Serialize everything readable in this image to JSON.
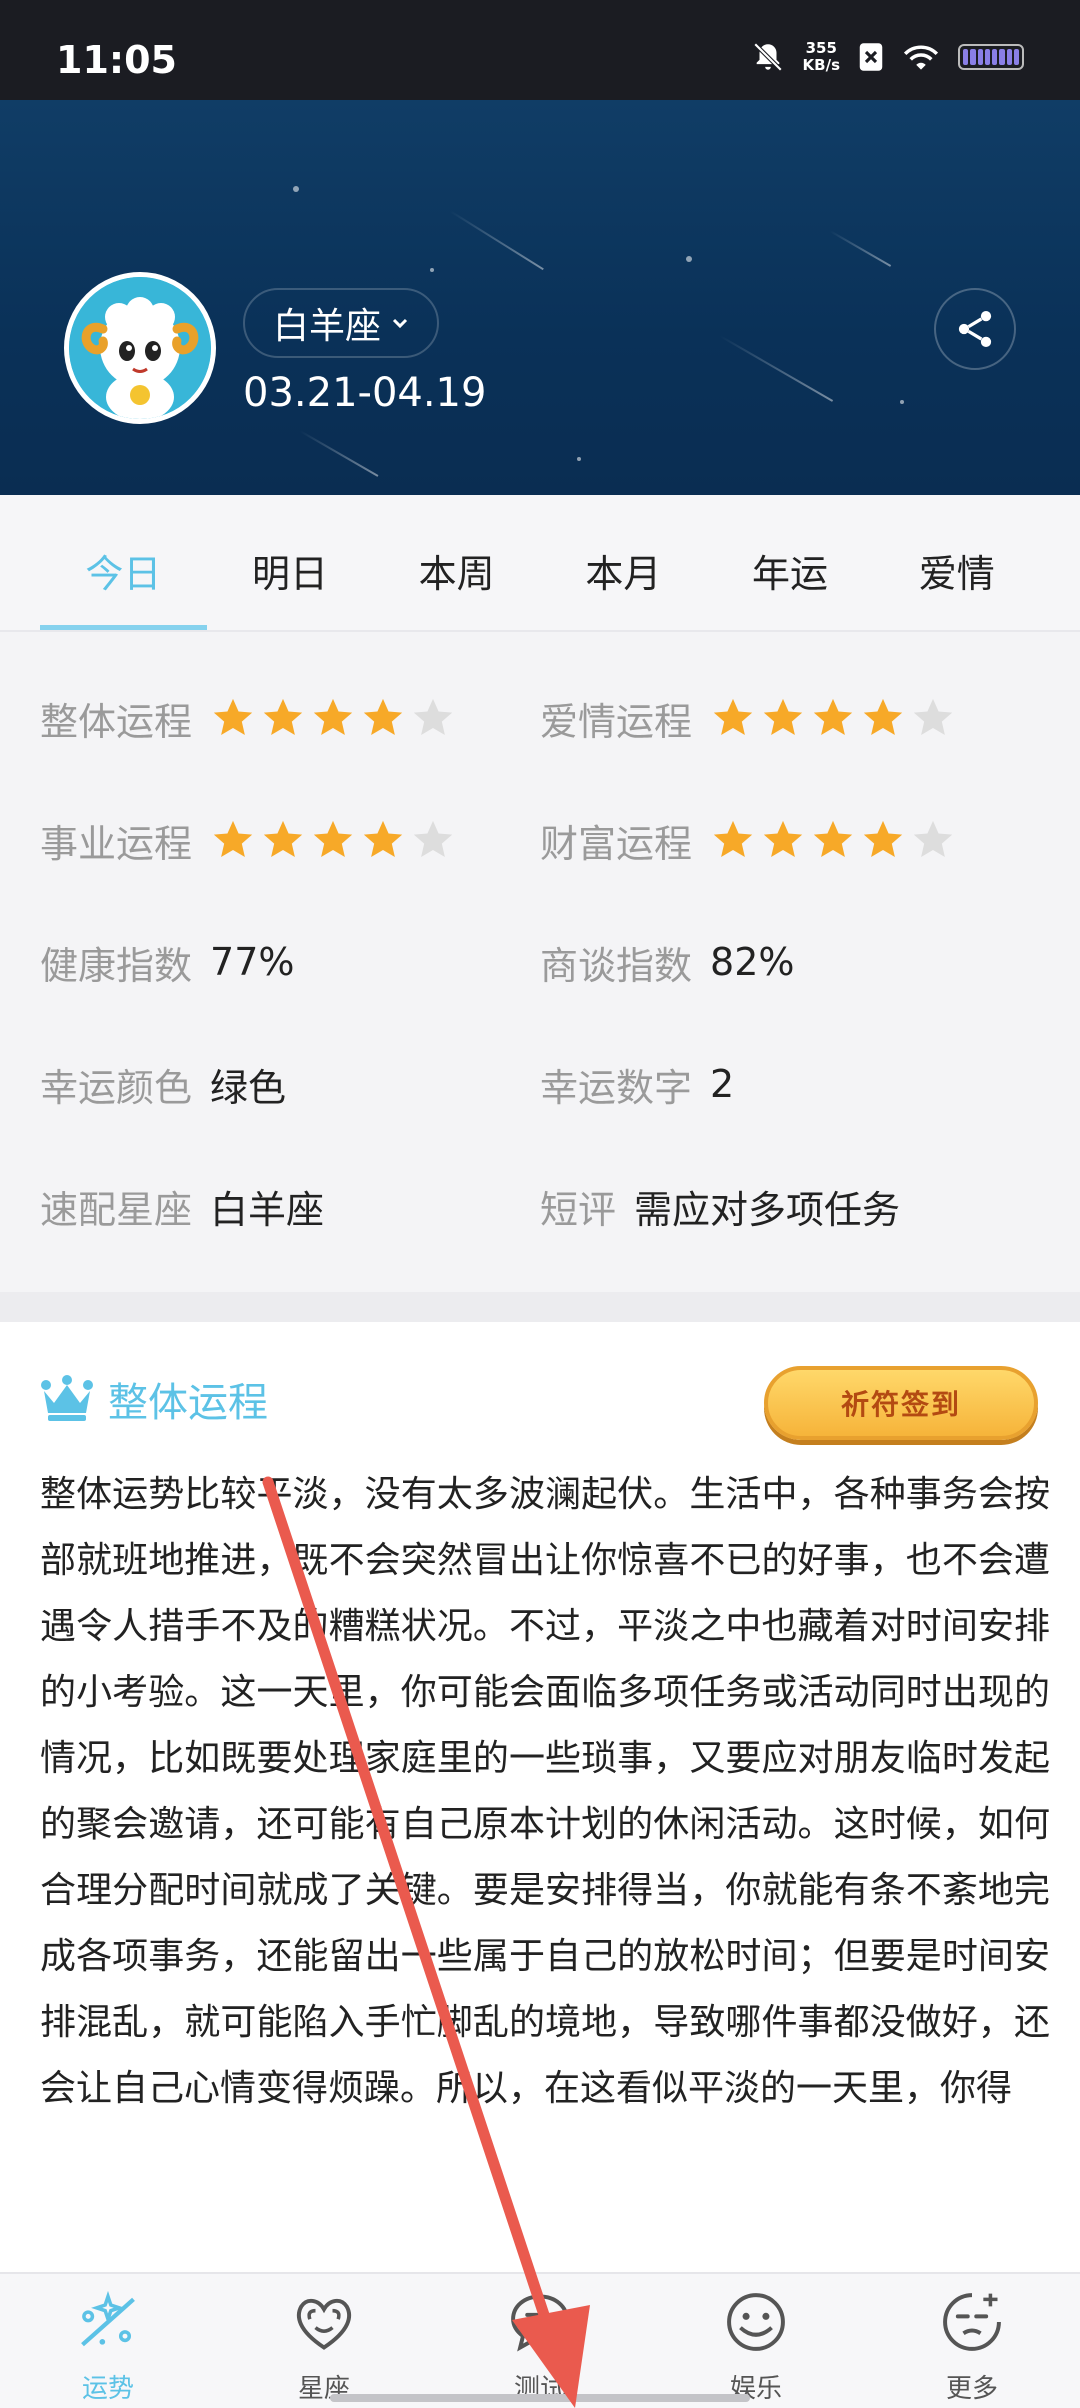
{
  "status_bar": {
    "time": "11:05",
    "net_speed_value": "355",
    "net_speed_unit": "KB/s"
  },
  "header": {
    "sign_name": "白羊座",
    "date_range": "03.21-04.19"
  },
  "tabs": [
    {
      "label": "今日",
      "active": true
    },
    {
      "label": "明日",
      "active": false
    },
    {
      "label": "本周",
      "active": false
    },
    {
      "label": "本月",
      "active": false
    },
    {
      "label": "年运",
      "active": false
    },
    {
      "label": "爱情",
      "active": false
    }
  ],
  "stats": {
    "overall": {
      "label": "整体运程",
      "stars": 4,
      "max_stars": 5
    },
    "love": {
      "label": "爱情运程",
      "stars": 4,
      "max_stars": 5
    },
    "career": {
      "label": "事业运程",
      "stars": 4,
      "max_stars": 5
    },
    "wealth": {
      "label": "财富运程",
      "stars": 4,
      "max_stars": 5
    },
    "health": {
      "label": "健康指数",
      "value": "77%"
    },
    "negotiation": {
      "label": "商谈指数",
      "value": "82%"
    },
    "lucky_color": {
      "label": "幸运颜色",
      "value": "绿色"
    },
    "lucky_number": {
      "label": "幸运数字",
      "value": "2"
    },
    "match_sign": {
      "label": "速配星座",
      "value": "白羊座"
    },
    "comment": {
      "label": "短评",
      "value": "需应对多项任务"
    }
  },
  "article": {
    "title": "整体运程",
    "signin_label": "祈符签到",
    "body": "整体运势比较平淡，没有太多波澜起伏。生活中，各种事务会按部就班地推进，既不会突然冒出让你惊喜不已的好事，也不会遭遇令人措手不及的糟糕状况。不过，平淡之中也藏着对时间安排的小考验。这一天里，你可能会面临多项任务或活动同时出现的情况，比如既要处理家庭里的一些琐事，又要应对朋友临时发起的聚会邀请，还可能有自己原本计划的休闲活动。这时候，如何合理分配时间就成了关键。要是安排得当，你就能有条不紊地完成各项事务，还能留出一些属于自己的放松时间；但要是时间安排混乱，就可能陷入手忙脚乱的境地，导致哪件事都没做好，还会让自己心情变得烦躁。所以，在这看似平淡的一天里，你得"
  },
  "bottom_nav": [
    {
      "label": "运势",
      "icon": "fortune-icon",
      "active": true
    },
    {
      "label": "星座",
      "icon": "constellation-icon",
      "active": false
    },
    {
      "label": "测试",
      "icon": "test-chat-icon",
      "active": false
    },
    {
      "label": "娱乐",
      "icon": "smile-icon",
      "active": false
    },
    {
      "label": "更多",
      "icon": "more-face-icon",
      "active": false
    }
  ],
  "colors": {
    "accent": "#5cc2e6",
    "header_bg": "#0a3158",
    "star_on": "#f7a928",
    "star_off": "#dddddd",
    "annotation_arrow": "#ea5a4e"
  }
}
